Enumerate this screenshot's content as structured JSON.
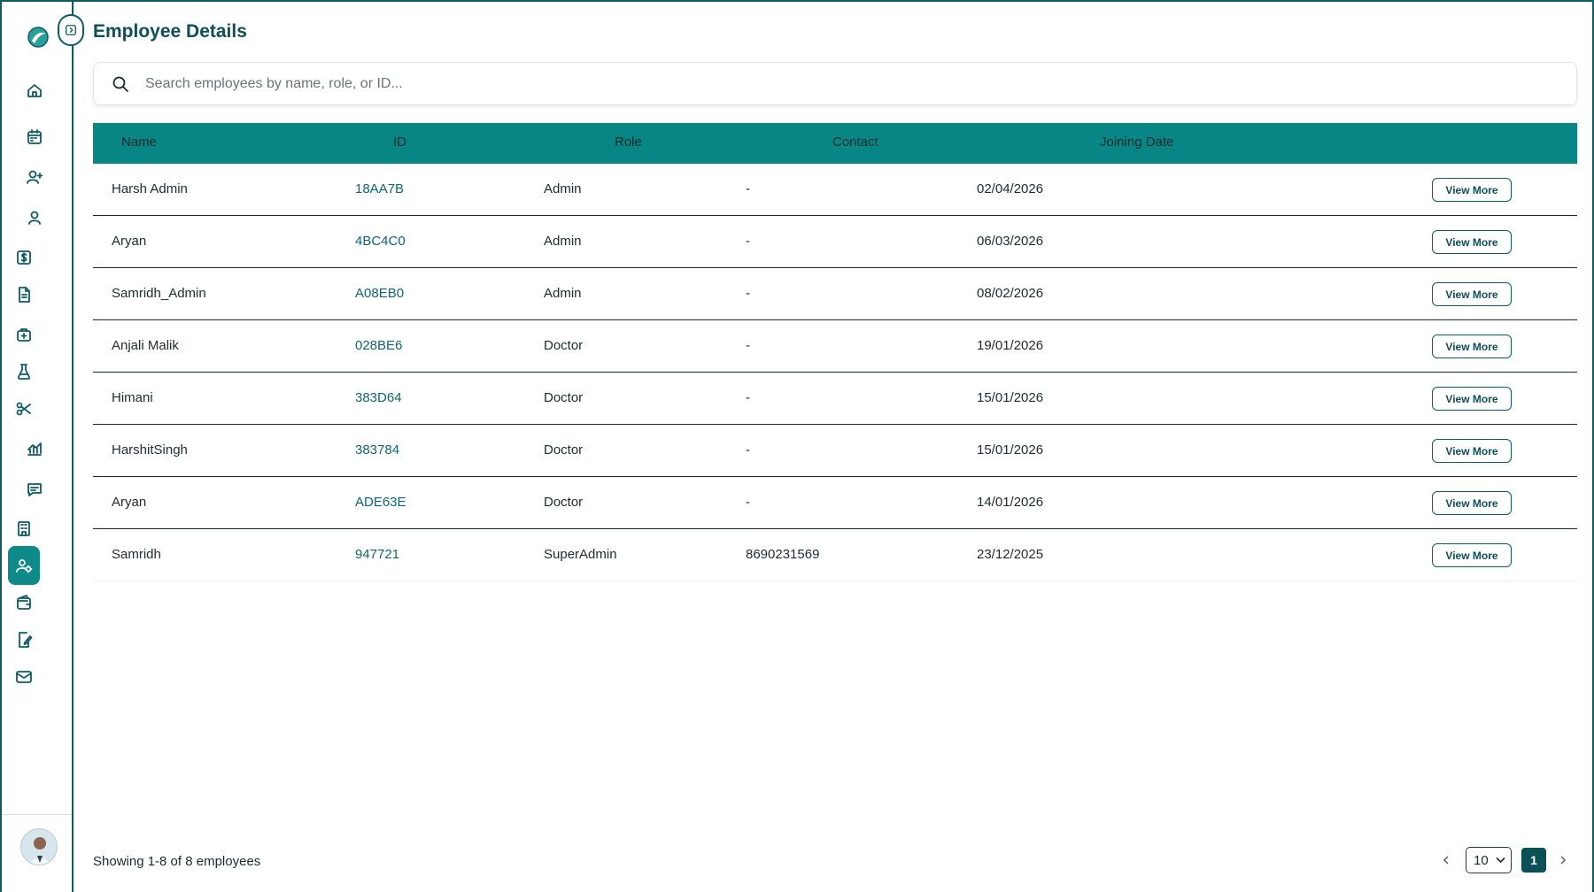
{
  "page": {
    "title": "Employee Details",
    "search_placeholder": "Search employees by name, role, or ID..."
  },
  "sidebar": {
    "items": [
      {
        "name": "home-icon"
      },
      {
        "name": "calendar-icon"
      },
      {
        "name": "user-plus-icon"
      },
      {
        "name": "user-icon"
      },
      {
        "name": "billing-icon"
      },
      {
        "name": "document-icon"
      },
      {
        "name": "medical-kit-icon"
      },
      {
        "name": "lab-flask-icon"
      },
      {
        "name": "scissors-icon"
      },
      {
        "name": "analytics-icon"
      },
      {
        "name": "message-icon"
      },
      {
        "name": "building-icon"
      },
      {
        "name": "employees-icon",
        "active": true
      },
      {
        "name": "wallet-icon"
      },
      {
        "name": "edit-file-icon"
      },
      {
        "name": "mail-icon"
      }
    ]
  },
  "table": {
    "columns": [
      "Name",
      "ID",
      "Role",
      "Contact",
      "Joining Date"
    ],
    "action_label": "View More",
    "rows": [
      {
        "name": "Harsh Admin",
        "id": "18AA7B",
        "role": "Admin",
        "contact": "-",
        "joining_date": "02/04/2026"
      },
      {
        "name": "Aryan",
        "id": "4BC4C0",
        "role": "Admin",
        "contact": "-",
        "joining_date": "06/03/2026"
      },
      {
        "name": "Samridh_Admin",
        "id": "A08EB0",
        "role": "Admin",
        "contact": "-",
        "joining_date": "08/02/2026"
      },
      {
        "name": "Anjali Malik",
        "id": "028BE6",
        "role": "Doctor",
        "contact": "-",
        "joining_date": "19/01/2026"
      },
      {
        "name": "Himani",
        "id": "383D64",
        "role": "Doctor",
        "contact": "-",
        "joining_date": "15/01/2026"
      },
      {
        "name": "HarshitSingh",
        "id": "383784",
        "role": "Doctor",
        "contact": "-",
        "joining_date": "15/01/2026"
      },
      {
        "name": "Aryan",
        "id": "ADE63E",
        "role": "Doctor",
        "contact": "-",
        "joining_date": "14/01/2026"
      },
      {
        "name": "Samridh",
        "id": "947721",
        "role": "SuperAdmin",
        "contact": "8690231569",
        "joining_date": "23/12/2025"
      }
    ]
  },
  "footer": {
    "summary": "Showing 1-8 of 8 employees",
    "page_size": "10",
    "current_page": "1"
  },
  "colors": {
    "primary": "#0d5c63",
    "header_bg": "#088585",
    "active_nav": "#0e8a8a"
  }
}
